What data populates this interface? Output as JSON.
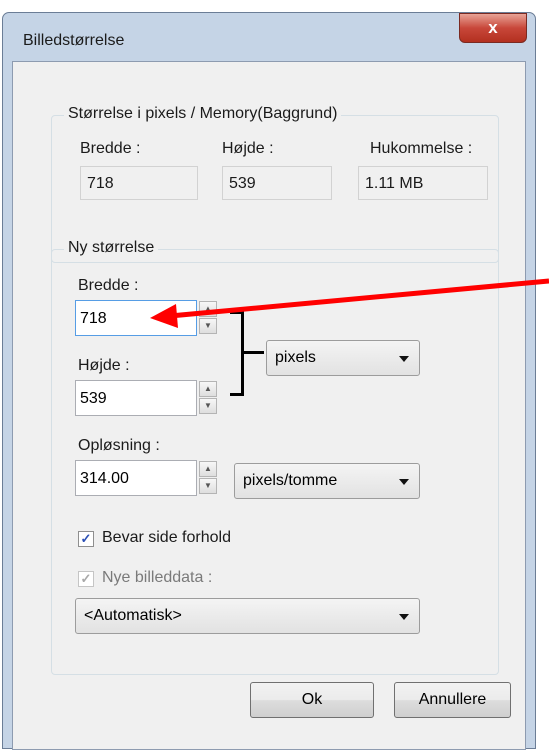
{
  "window": {
    "title": "Billedstørrelse",
    "close_label": "x"
  },
  "current_size": {
    "legend": "Størrelse i pixels / Memory(Baggrund)",
    "width_label": "Bredde :",
    "width_value": "718",
    "height_label": "Højde :",
    "height_value": "539",
    "memory_label": "Hukommelse :",
    "memory_value": "1.11 MB"
  },
  "new_size": {
    "legend": "Ny størrelse",
    "width_label": "Bredde :",
    "width_value": "718",
    "height_label": "Højde :",
    "height_value": "539",
    "unit_selected": "pixels",
    "resolution_label": "Opløsning :",
    "resolution_value": "314.00",
    "resolution_unit_selected": "pixels/tomme",
    "keep_aspect_label": "Bevar side forhold",
    "keep_aspect_checked": true,
    "new_image_data_label": "Nye billeddata :",
    "new_image_data_checked": true,
    "new_image_data_enabled": false,
    "resample_selected": "<Automatisk>"
  },
  "buttons": {
    "ok_label": "Ok",
    "cancel_label": "Annullere"
  },
  "colors": {
    "annotation_arrow": "#ff0000",
    "close_button": "#c8473a",
    "focus_border": "#569de5"
  },
  "icons": {
    "spin_up": "spin-up-arrow-icon",
    "spin_down": "spin-down-arrow-icon",
    "dropdown": "chevron-down-icon",
    "checkmark": "checkmark-icon"
  }
}
